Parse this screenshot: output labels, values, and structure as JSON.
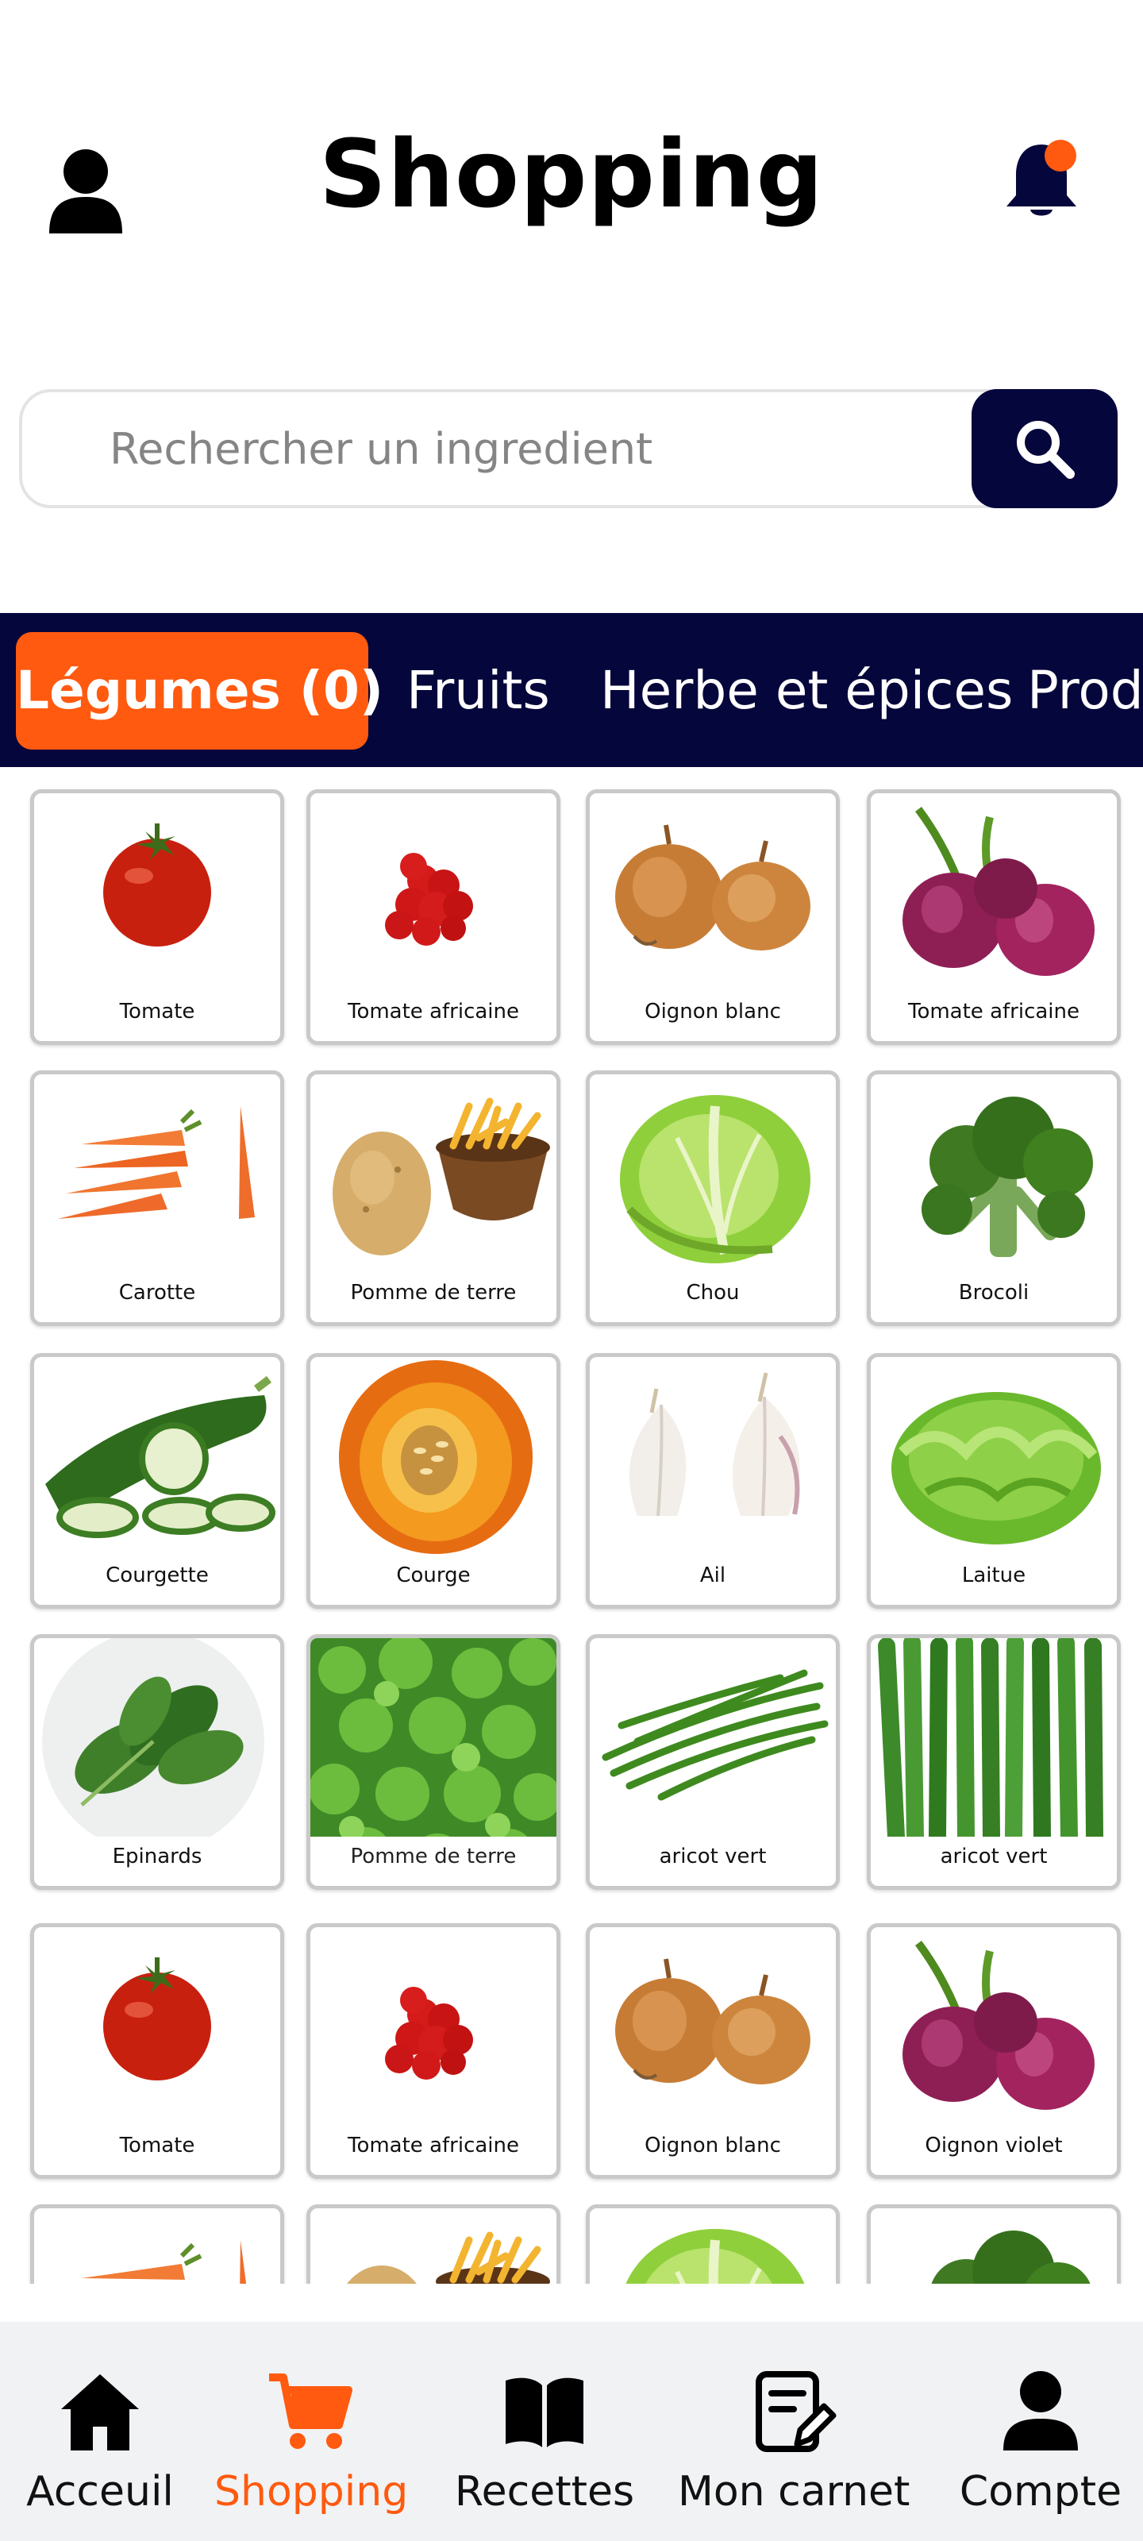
{
  "header": {
    "title": "Shopping",
    "user_icon": "user-icon",
    "bell_icon": "bell-icon",
    "notification_dot_color": "#ff5a0f"
  },
  "search": {
    "placeholder": "Rechercher un ingredient",
    "button_icon": "search-icon"
  },
  "tabs": [
    {
      "label": "Légumes (0)",
      "active": true
    },
    {
      "label": "Fruits",
      "active": false
    },
    {
      "label": "Herbe et épices",
      "active": false
    },
    {
      "label": "Prod",
      "active": false
    }
  ],
  "products": [
    {
      "label": "Tomate",
      "icon": "tomato"
    },
    {
      "label": "Tomate africaine",
      "icon": "african-tomato"
    },
    {
      "label": "Oignon blanc",
      "icon": "onion"
    },
    {
      "label": "Tomate africaine",
      "icon": "red-onion"
    },
    {
      "label": "Carotte",
      "icon": "carrot"
    },
    {
      "label": "Pomme de terre",
      "icon": "potato"
    },
    {
      "label": "Chou",
      "icon": "cabbage"
    },
    {
      "label": "Brocoli",
      "icon": "broccoli"
    },
    {
      "label": "Courgette",
      "icon": "zucchini"
    },
    {
      "label": "Courge",
      "icon": "pumpkin"
    },
    {
      "label": "Ail",
      "icon": "garlic"
    },
    {
      "label": "Laitue",
      "icon": "lettuce"
    },
    {
      "label": "Epinards",
      "icon": "spinach"
    },
    {
      "label": "Pomme de terre",
      "icon": "parsley"
    },
    {
      "label": "aricot vert",
      "icon": "green-beans"
    },
    {
      "label": "aricot vert",
      "icon": "green-beans-bunch"
    },
    {
      "label": "Tomate",
      "icon": "tomato"
    },
    {
      "label": "Tomate africaine",
      "icon": "african-tomato"
    },
    {
      "label": "Oignon blanc",
      "icon": "onion"
    },
    {
      "label": "Oignon violet",
      "icon": "red-onion"
    },
    {
      "label": "",
      "icon": "carrot"
    },
    {
      "label": "",
      "icon": "potato"
    },
    {
      "label": "",
      "icon": "cabbage"
    },
    {
      "label": "",
      "icon": "broccoli"
    }
  ],
  "nav": [
    {
      "label": "Acceuil",
      "icon": "home-icon",
      "active": false
    },
    {
      "label": "Shopping",
      "icon": "cart-icon",
      "active": true
    },
    {
      "label": "Recettes",
      "icon": "book-icon",
      "active": false
    },
    {
      "label": "Mon carnet",
      "icon": "notebook-edit-icon",
      "active": false
    },
    {
      "label": "Compte",
      "icon": "account-icon",
      "active": false
    }
  ],
  "colors": {
    "navy": "#05063b",
    "accent": "#ff5a0f"
  }
}
